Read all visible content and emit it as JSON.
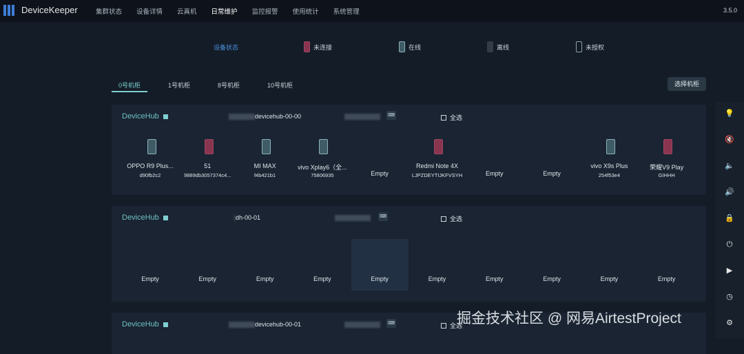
{
  "app": {
    "title": "DeviceKeeper",
    "version": "3.5.0"
  },
  "nav": [
    {
      "label": "集群状态"
    },
    {
      "label": "设备详情"
    },
    {
      "label": "云真机"
    },
    {
      "label": "日常维护",
      "active": true
    },
    {
      "label": "监控报警"
    },
    {
      "label": "使用统计"
    },
    {
      "label": "系统管理"
    }
  ],
  "legend": {
    "title": "设备状态",
    "items": [
      {
        "label": "未连接",
        "color": "#8a3550",
        "border": "#a04560"
      },
      {
        "label": "在线",
        "color": "#3f5c66",
        "border": "#8fb2bb"
      },
      {
        "label": "离线",
        "color": "#333c47",
        "border": "#333c47"
      },
      {
        "label": "未授权",
        "color": "#121a24",
        "border": "#8fa2ad"
      }
    ]
  },
  "tabs": [
    {
      "label": "0号机柜",
      "active": true
    },
    {
      "label": "1号机柜"
    },
    {
      "label": "8号机柜"
    },
    {
      "label": "10号机柜"
    }
  ],
  "select_cabinet": "选择机柜",
  "hubs": [
    {
      "title": "DeviceHub",
      "host": "devicehub-00-00",
      "select_all": "全选",
      "slots": [
        {
          "name": "OPPO R9 Plus...",
          "serial": "d90fb2c2",
          "status": "在线"
        },
        {
          "name": "51",
          "serial": "9889db3057374c4...",
          "status": "未连接"
        },
        {
          "name": "MI MAX",
          "serial": "f4b421b1",
          "status": "在线"
        },
        {
          "name": "vivo Xplay6（全...",
          "serial": "75806935",
          "status": "在线"
        },
        {
          "name": "Empty"
        },
        {
          "name": "Redmi Note 4X",
          "serial": "LJPZDEYTIJKFVSYH",
          "status": "未连接"
        },
        {
          "name": "Empty"
        },
        {
          "name": "Empty"
        },
        {
          "name": "vivo X9s Plus",
          "serial": "254f53e4",
          "status": "在线"
        },
        {
          "name": "荣耀V9 Play",
          "serial": "GIHHH",
          "status": "未连接"
        }
      ]
    },
    {
      "title": "DeviceHub",
      "host": "dh-00-01",
      "select_all": "全选",
      "slots": [
        {
          "name": "Empty"
        },
        {
          "name": "Empty"
        },
        {
          "name": "Empty"
        },
        {
          "name": "Empty"
        },
        {
          "name": "Empty",
          "hover": true
        },
        {
          "name": "Empty"
        },
        {
          "name": "Empty"
        },
        {
          "name": "Empty"
        },
        {
          "name": "Empty"
        },
        {
          "name": "Empty"
        }
      ]
    },
    {
      "title": "DeviceHub",
      "host": "devicehub-00-01",
      "select_all": "全选",
      "slots": []
    }
  ],
  "side_tools": [
    {
      "icon": "bulb-icon",
      "glyph": "💡"
    },
    {
      "icon": "mute-icon",
      "glyph": "🔇"
    },
    {
      "icon": "volume-down-icon",
      "glyph": "🔈"
    },
    {
      "icon": "volume-up-icon",
      "glyph": "🔊"
    },
    {
      "icon": "lock-icon",
      "glyph": "🔒"
    },
    {
      "icon": "power-icon",
      "glyph": "⏻"
    },
    {
      "icon": "play-icon",
      "glyph": "▶"
    },
    {
      "icon": "clock-icon",
      "glyph": "◷"
    },
    {
      "icon": "settings-icon",
      "glyph": "⚙"
    }
  ],
  "watermark": "掘金技术社区 @ 网易AirtestProject"
}
